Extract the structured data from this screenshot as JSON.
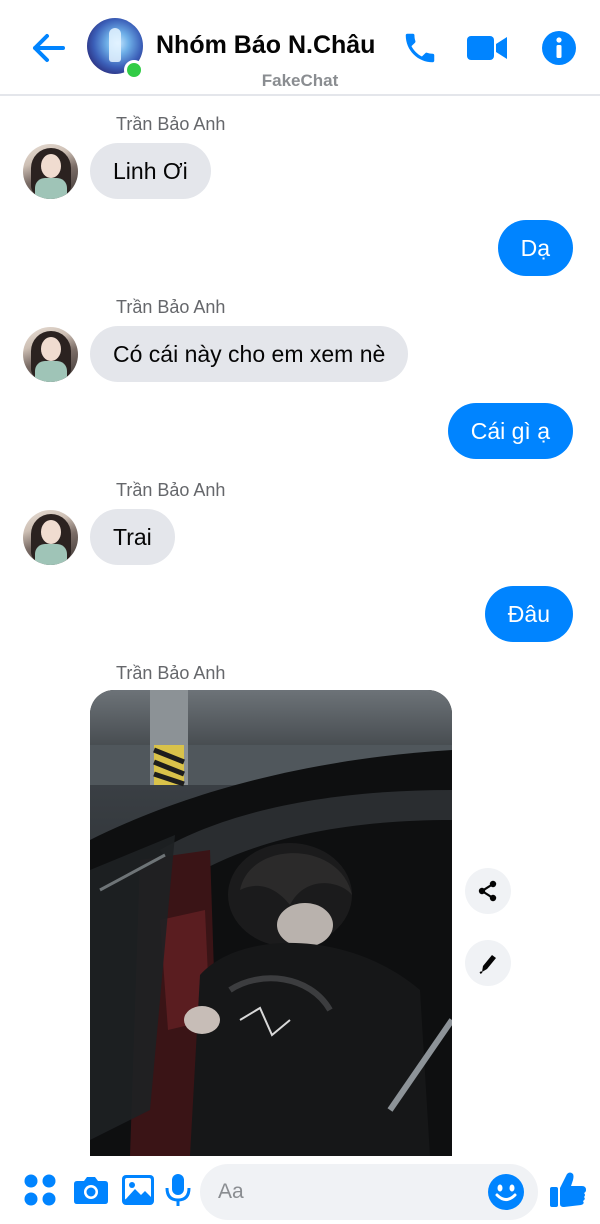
{
  "header": {
    "back_icon": "arrow-left-icon",
    "title": "Nhóm Báo N.Châu",
    "subtitle": "FakeChat",
    "online": true,
    "actions": [
      "phone-icon",
      "video-icon",
      "info-icon"
    ]
  },
  "messages": [
    {
      "direction": "incoming",
      "sender": "Trần Bảo Anh",
      "text": "Linh Ơi"
    },
    {
      "direction": "outgoing",
      "text": "Dạ"
    },
    {
      "direction": "incoming",
      "sender": "Trần Bảo Anh",
      "text": "Có cái này cho em xem nè"
    },
    {
      "direction": "outgoing",
      "text": "Cái gì ạ"
    },
    {
      "direction": "incoming",
      "sender": "Trần Bảo Anh",
      "text": "Trai"
    },
    {
      "direction": "outgoing",
      "text": "Đâu"
    },
    {
      "direction": "incoming",
      "sender": "Trần Bảo Anh",
      "type": "photo"
    }
  ],
  "photo_actions": [
    "share-icon",
    "edit-icon"
  ],
  "composer": {
    "placeholder": "Aa",
    "icons": [
      "apps-grid-icon",
      "camera-icon",
      "gallery-icon",
      "microphone-icon",
      "emoji-icon",
      "thumbs-up-icon"
    ]
  },
  "colors": {
    "accent": "#0084ff",
    "incoming_bubble": "#e4e6eb",
    "online": "#31cc46",
    "muted_text": "#65676b"
  }
}
